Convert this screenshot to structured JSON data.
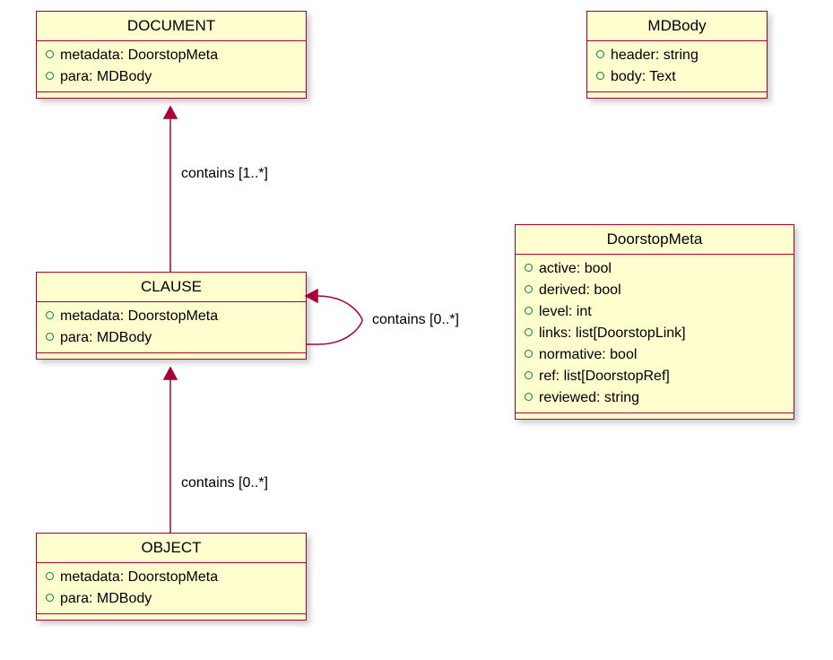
{
  "classes": {
    "document": {
      "name": "DOCUMENT",
      "attrs": [
        "metadata: DoorstopMeta",
        "para: MDBody"
      ]
    },
    "clause": {
      "name": "CLAUSE",
      "attrs": [
        "metadata: DoorstopMeta",
        "para: MDBody"
      ]
    },
    "object": {
      "name": "OBJECT",
      "attrs": [
        "metadata: DoorstopMeta",
        "para: MDBody"
      ]
    },
    "mdbody": {
      "name": "MDBody",
      "attrs": [
        "header: string",
        "body: Text"
      ]
    },
    "doorstopmeta": {
      "name": "DoorstopMeta",
      "attrs": [
        "active: bool",
        "derived: bool",
        "level: int",
        "links: list[DoorstopLink]",
        "normative: bool",
        "ref: list[DoorstopRef]",
        "reviewed: string"
      ]
    }
  },
  "labels": {
    "doc_clause": "contains [1..*]",
    "clause_self": "contains [0..*]",
    "clause_object": "contains [0..*]"
  }
}
